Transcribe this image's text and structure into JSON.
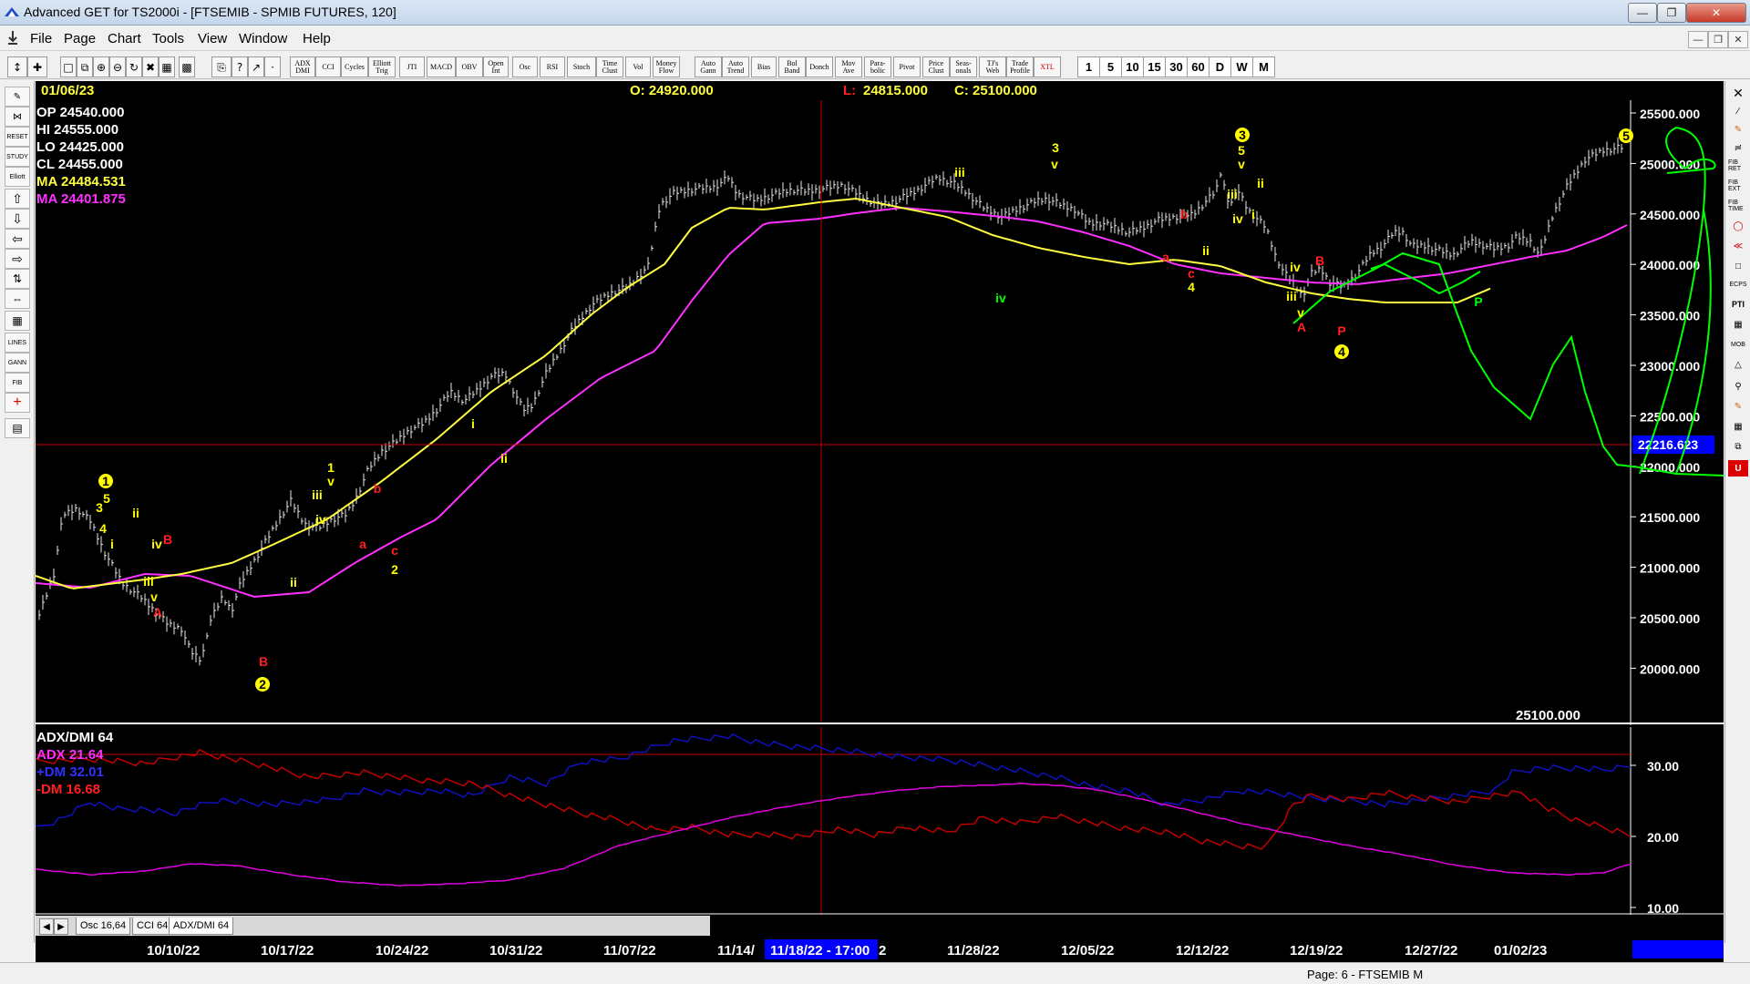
{
  "window": {
    "title": "Advanced GET for TS2000i - [FTSEMIB - SPMIB FUTURES, 120]"
  },
  "menu": [
    "File",
    "Page",
    "Chart",
    "Tools",
    "View",
    "Window",
    "Help"
  ],
  "toolbar": {
    "tools": [
      "ADX DMI",
      "CCI",
      "Cycles",
      "Elliott Trig",
      "JTI",
      "MACD",
      "OBV",
      "Open Int",
      "Osc",
      "RSI",
      "Stoch",
      "Time Clust",
      "Vol",
      "Money Flow",
      "Auto Gann",
      "Auto Trend",
      "Bias",
      "Bol Band",
      "Donch",
      "Mov Ave",
      "Para-bolic",
      "Pivot",
      "Price Clust",
      "Seas-onals",
      "TJ's Web",
      "Trade Profile",
      "XTL"
    ],
    "timeframes": [
      "1",
      "5",
      "10",
      "15",
      "30",
      "60",
      "D",
      "W",
      "M"
    ]
  },
  "info_bar": {
    "date": "01/06/23",
    "open": "O: 24920.000",
    "low_label": "L:",
    "low_value": "24815.000",
    "close": "C: 25100.000"
  },
  "price_legend": [
    {
      "label": "OP",
      "value": "24540.000",
      "color": "#ffffff"
    },
    {
      "label": "HI",
      "value": "24555.000",
      "color": "#ffffff"
    },
    {
      "label": "LO",
      "value": "24425.000",
      "color": "#ffffff"
    },
    {
      "label": "CL",
      "value": "24455.000",
      "color": "#ffffff"
    },
    {
      "label": "MA",
      "value": "24484.531",
      "color": "#ffff40"
    },
    {
      "label": "MA",
      "value": "24401.875",
      "color": "#ff30ff"
    }
  ],
  "price_axis": {
    "ticks": [
      "25500.000",
      "25000.000",
      "24500.000",
      "24000.000",
      "23500.000",
      "23000.000",
      "22500.000",
      "22000.000",
      "21500.000",
      "21000.000",
      "20500.000",
      "20000.000"
    ],
    "cursor_value": "22216.623",
    "last_value": "25100.000"
  },
  "indicator": {
    "title": "ADX/DMI 64",
    "adx": "ADX 21.64",
    "pdm": "+DM 32.01",
    "mdm": "-DM 16.68",
    "ticks": [
      "30.00",
      "20.00",
      "10.00"
    ]
  },
  "tabs": [
    "Osc 16,64",
    "CCI 64",
    "ADX/DMI 64"
  ],
  "dates": [
    "10/10/22",
    "10/17/22",
    "10/24/22",
    "10/31/22",
    "11/07/22",
    "11/14/",
    "2",
    "11/28/22",
    "12/05/22",
    "12/12/22",
    "12/19/22",
    "12/27/22",
    "01/02/23"
  ],
  "cursor_date": "11/18/22 - 17:00",
  "status": "Page: 6 - FTSEMIB M",
  "wave_labels": [
    {
      "t": "1",
      "c": "#ffff00",
      "circle": true
    },
    {
      "t": "5",
      "c": "#ffff00"
    },
    {
      "t": "3",
      "c": "#ffff00"
    },
    {
      "t": "4",
      "c": "#ffff00"
    },
    {
      "t": "i",
      "c": "#ffff00"
    },
    {
      "t": "ii",
      "c": "#ffff00"
    },
    {
      "t": "iv",
      "c": "#ffff00"
    },
    {
      "t": "B",
      "c": "#ff2020"
    },
    {
      "t": "iii",
      "c": "#ffff00"
    },
    {
      "t": "v",
      "c": "#ffff00"
    },
    {
      "t": "A",
      "c": "#ff2020"
    },
    {
      "t": "B",
      "c": "#ff2020"
    },
    {
      "t": "2",
      "c": "#ffff00",
      "circle": true
    },
    {
      "t": "1",
      "c": "#ffff00"
    },
    {
      "t": "v",
      "c": "#ffff00"
    },
    {
      "t": "iii",
      "c": "#ffff00"
    },
    {
      "t": "iv",
      "c": "#ffff00"
    },
    {
      "t": "ii",
      "c": "#ffff00"
    },
    {
      "t": "b",
      "c": "#ff2020"
    },
    {
      "t": "a",
      "c": "#ff2020"
    },
    {
      "t": "c",
      "c": "#ff2020"
    },
    {
      "t": "2",
      "c": "#ffff00"
    },
    {
      "t": "i",
      "c": "#ffff00"
    },
    {
      "t": "ii",
      "c": "#ffff00"
    },
    {
      "t": "iii",
      "c": "#ffff00"
    },
    {
      "t": "3",
      "c": "#ffff00"
    },
    {
      "t": "v",
      "c": "#ffff00"
    },
    {
      "t": "iv",
      "c": "#00ff00"
    },
    {
      "t": "3",
      "c": "#ffff00",
      "circle": true
    },
    {
      "t": "5",
      "c": "#ffff00"
    },
    {
      "t": "v",
      "c": "#ffff00"
    },
    {
      "t": "iii",
      "c": "#ffff00"
    },
    {
      "t": "ii",
      "c": "#ffff00"
    },
    {
      "t": "iv",
      "c": "#ffff00"
    },
    {
      "t": "i",
      "c": "#ffff00"
    },
    {
      "t": "b",
      "c": "#ff2020"
    },
    {
      "t": "a",
      "c": "#ff2020"
    },
    {
      "t": "c",
      "c": "#ff2020"
    },
    {
      "t": "4",
      "c": "#ffff00"
    },
    {
      "t": "ii",
      "c": "#ffff00"
    },
    {
      "t": "iv",
      "c": "#ffff00"
    },
    {
      "t": "iii",
      "c": "#ffff00"
    },
    {
      "t": "v",
      "c": "#ffff00"
    },
    {
      "t": "A",
      "c": "#ff2020"
    },
    {
      "t": "B",
      "c": "#ff2020"
    },
    {
      "t": "P",
      "c": "#ff2020"
    },
    {
      "t": "4",
      "c": "#ffff00",
      "circle": true
    },
    {
      "t": "P",
      "c": "#00ff00"
    },
    {
      "t": "5",
      "c": "#ffff00",
      "circle": true
    }
  ],
  "colors": {
    "bg": "#000000",
    "ma_fast": "#ffff40",
    "ma_slow": "#ff30ff",
    "cursor": "#c00000",
    "forecast": "#00ff00",
    "pdm": "#1010c0",
    "mdm": "#c00000",
    "adx": "#e000e0",
    "axis": "#ffffff",
    "date_bar": "#0000ff"
  }
}
